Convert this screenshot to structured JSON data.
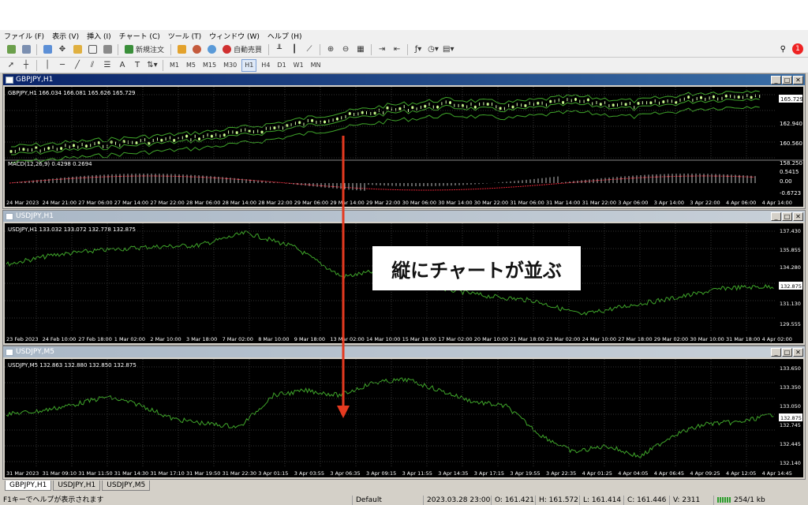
{
  "menu": [
    "ファイル (F)",
    "表示 (V)",
    "挿入 (I)",
    "チャート (C)",
    "ツール (T)",
    "ウィンドウ (W)",
    "ヘルプ (H)"
  ],
  "toolbar": {
    "new_order_label": "新規注文",
    "auto_trade_label": "自動売買",
    "badge_count": "1",
    "timeframes": [
      "M1",
      "M5",
      "M15",
      "M30",
      "H1",
      "H4",
      "D1",
      "W1",
      "MN"
    ],
    "active_timeframe": "H1"
  },
  "windows": [
    {
      "title": "GBPJPY,H1",
      "info": "GBPJPY,H1  166.034 166.081 165.626 165.729",
      "indicator": "MACD(12,26,9) 0.4298 0.2694",
      "price_labels": [
        "165.729",
        "162.940",
        "160.560",
        "158.250"
      ],
      "current_price": "165.729",
      "macd_labels": [
        "0.5415",
        "0.00",
        "-0.6723"
      ],
      "time_labels": [
        "24 Mar 2023",
        "24 Mar 21:00",
        "27 Mar 06:00",
        "27 Mar 14:00",
        "27 Mar 22:00",
        "28 Mar 06:00",
        "28 Mar 14:00",
        "28 Mar 22:00",
        "29 Mar 06:00",
        "29 Mar 14:00",
        "29 Mar 22:00",
        "30 Mar 06:00",
        "30 Mar 14:00",
        "30 Mar 22:00",
        "31 Mar 06:00",
        "31 Mar 14:00",
        "31 Mar 22:00",
        "3 Apr 06:00",
        "3 Apr 14:00",
        "3 Apr 22:00",
        "4 Apr 06:00",
        "4 Apr 14:00"
      ]
    },
    {
      "title": "USDJPY,H1",
      "info": "USDJPY,H1  133.032 133.072 132.778 132.875",
      "price_labels": [
        "137.430",
        "135.855",
        "134.280",
        "132.875",
        "131.130",
        "129.555"
      ],
      "current_price": "132.875",
      "time_labels": [
        "23 Feb 2023",
        "24 Feb 10:00",
        "27 Feb 18:00",
        "1 Mar 02:00",
        "2 Mar 10:00",
        "3 Mar 18:00",
        "7 Mar 02:00",
        "8 Mar 10:00",
        "9 Mar 18:00",
        "13 Mar 02:00",
        "14 Mar 10:00",
        "15 Mar 18:00",
        "17 Mar 02:00",
        "20 Mar 10:00",
        "21 Mar 18:00",
        "23 Mar 02:00",
        "24 Mar 10:00",
        "27 Mar 18:00",
        "29 Mar 02:00",
        "30 Mar 10:00",
        "31 Mar 18:00",
        "4 Apr 02:00"
      ]
    },
    {
      "title": "USDJPY,M5",
      "info": "USDJPY,M5  132.863 132.880 132.850 132.875",
      "price_labels": [
        "133.650",
        "133.350",
        "133.050",
        "132.875",
        "132.745",
        "132.445",
        "132.140"
      ],
      "current_price": "132.875",
      "time_labels": [
        "31 Mar 2023",
        "31 Mar 09:10",
        "31 Mar 11:50",
        "31 Mar 14:30",
        "31 Mar 17:10",
        "31 Mar 19:50",
        "31 Mar 22:30",
        "3 Apr 01:15",
        "3 Apr 03:55",
        "3 Apr 06:35",
        "3 Apr 09:15",
        "3 Apr 11:55",
        "3 Apr 14:35",
        "3 Apr 17:15",
        "3 Apr 19:55",
        "3 Apr 22:35",
        "4 Apr 01:25",
        "4 Apr 04:05",
        "4 Apr 06:45",
        "4 Apr 09:25",
        "4 Apr 12:05",
        "4 Apr 14:45"
      ]
    }
  ],
  "annotation": "縦にチャートが並ぶ",
  "tabs": [
    "GBPJPY,H1",
    "USDJPY,H1",
    "USDJPY,M5"
  ],
  "active_tab": "GBPJPY,H1",
  "status": {
    "help": "F1キーでヘルプが表示されます",
    "profile": "Default",
    "datetime": "2023.03.28 23:00",
    "open": "O: 161.421",
    "high": "H: 161.572",
    "low": "L: 161.414",
    "close": "C: 161.446",
    "volume": "V: 2311",
    "traffic": "254/1 kb"
  },
  "colors": {
    "chart_line": "#3fa62a",
    "candle_up": "#b8f070",
    "annotation_arrow": "#e53a20",
    "active_title": "#0a246a",
    "badge": "#e22222"
  }
}
